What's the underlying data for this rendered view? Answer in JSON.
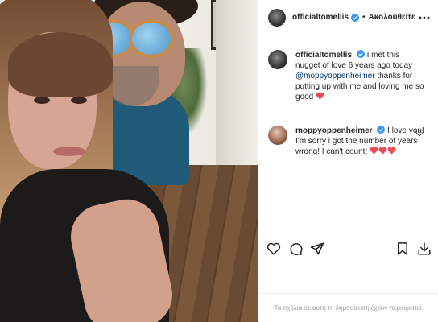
{
  "header": {
    "username": "officialtomellis",
    "separator": "•",
    "follow_label": "Ακολουθείτε",
    "icons": {
      "verified": "verified-badge-icon",
      "more": "more-options-icon"
    }
  },
  "caption": {
    "username": "officialtomellis",
    "text_before": " I met this nugget of love 6 years ago today ",
    "mention": "@moppyoppenheimer",
    "text_after": " thanks for putting up with me and loving me so good "
  },
  "comments": [
    {
      "username": "moppyoppenheimer",
      "text": " I love you! I'm sorry i got the number of years wrong! I can't count! "
    }
  ],
  "actions": {
    "icons": [
      "heart-outline-icon",
      "comment-icon",
      "share-icon",
      "bookmark-icon",
      "download-icon"
    ]
  },
  "footer": {
    "comments_disabled": "Τα σχόλια σε αυτή τη δημοσίευση έχουν περιοριστεί."
  },
  "colors": {
    "text": "#262626",
    "verified": "#3897f0",
    "heart": "#ed4956",
    "mention": "#00376b",
    "muted": "#a0a0a0",
    "divider": "#efefef"
  }
}
